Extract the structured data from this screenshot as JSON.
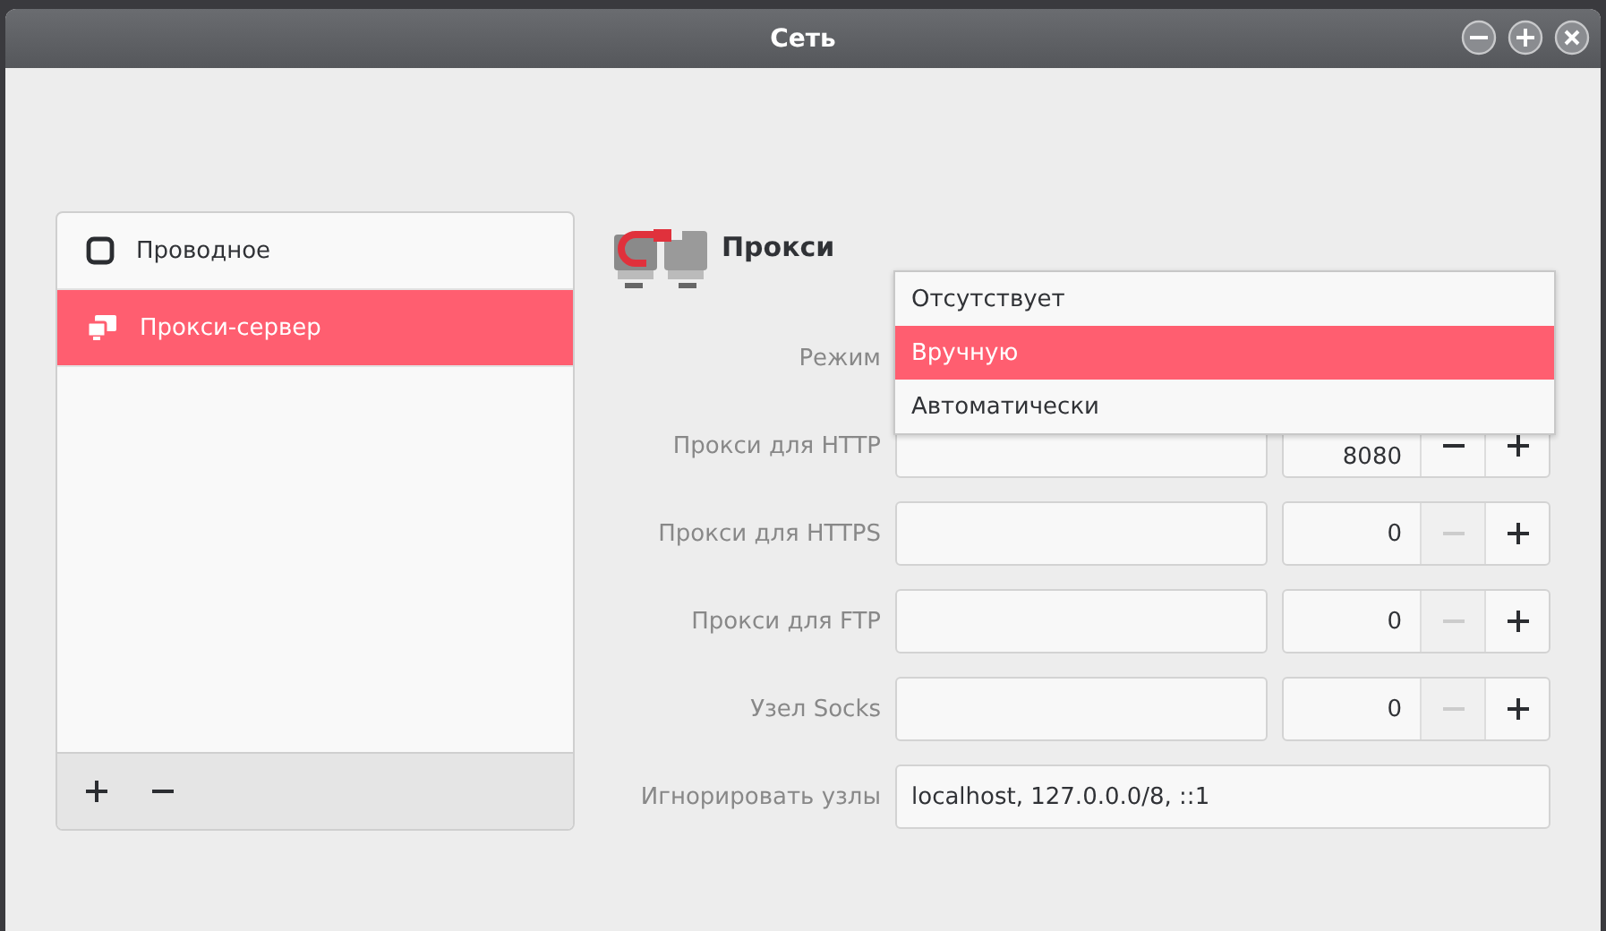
{
  "window": {
    "title": "Сеть"
  },
  "sidebar": {
    "items": [
      {
        "label": "Проводное",
        "kind": "wired",
        "selected": false
      },
      {
        "label": "Прокси-сервер",
        "kind": "proxy",
        "selected": true
      }
    ]
  },
  "panel": {
    "title": "Прокси",
    "mode": {
      "label": "Режим",
      "options": [
        {
          "label": "Отсутствует",
          "selected": false
        },
        {
          "label": "Вручную",
          "selected": true
        },
        {
          "label": "Автоматически",
          "selected": false
        }
      ]
    },
    "proxies": [
      {
        "label": "Прокси для HTTP",
        "port": "8080",
        "decrement_disabled": false
      },
      {
        "label": "Прокси для HTTPS",
        "port": "0",
        "decrement_disabled": true
      },
      {
        "label": "Прокси для FTP",
        "port": "0",
        "decrement_disabled": true
      },
      {
        "label": "Узел Socks",
        "port": "0",
        "decrement_disabled": true
      }
    ],
    "ignore": {
      "label": "Игнорировать узлы",
      "value": "localhost, 127.0.0.0/8, ::1"
    }
  }
}
